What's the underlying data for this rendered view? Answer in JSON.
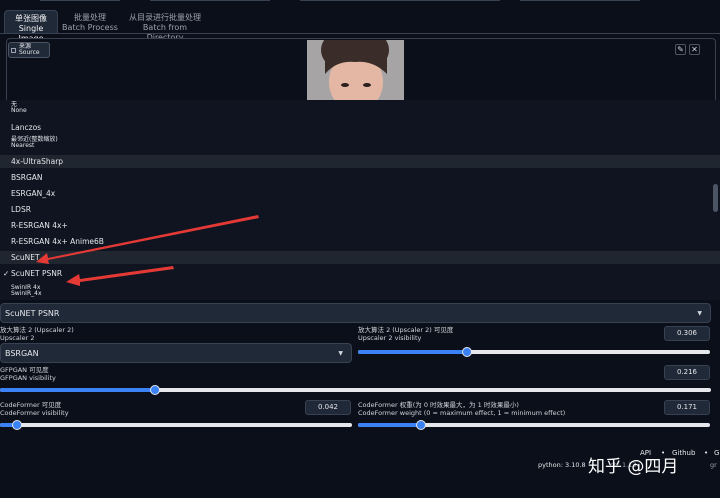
{
  "tabs": [
    {
      "zh": "单张图像",
      "en": "Single Image"
    },
    {
      "zh": "批量处理",
      "en": "Batch Process"
    },
    {
      "zh": "从目录进行批量处理",
      "en": "Batch from Directory"
    }
  ],
  "source": {
    "zh": "来源",
    "en": "Source"
  },
  "buttons": {
    "edit": "✎",
    "close": "✕"
  },
  "upscaler_options": [
    {
      "zh": "无",
      "en": "None"
    },
    {
      "label": "Lanczos"
    },
    {
      "zh": "最邻近(整数缩放)",
      "en": "Nearest"
    },
    {
      "label": "4x-UltraSharp"
    },
    {
      "label": "BSRGAN"
    },
    {
      "label": "ESRGAN_4x"
    },
    {
      "label": "LDSR"
    },
    {
      "label": "R-ESRGAN 4x+"
    },
    {
      "label": "R-ESRGAN 4x+ Anime6B"
    },
    {
      "label": "ScuNET"
    },
    {
      "label": "ScuNET PSNR",
      "check": "✓"
    },
    {
      "zh": "SwinIR 4x",
      "en": "SwinIR_4x"
    }
  ],
  "upscaler1": {
    "value": "ScuNET PSNR"
  },
  "upscaler2": {
    "label_zh": "放大算法 2 (Upscaler 2)",
    "label_en": "Upscaler 2",
    "value": "BSRGAN"
  },
  "upscaler2_visibility": {
    "label_zh": "放大算法 2 (Upscaler 2) 可见度",
    "label_en": "Upscaler 2 visibility",
    "value": "0.306"
  },
  "gfpgan": {
    "label_zh": "GFPGAN 可见度",
    "label_en": "GFPGAN visibility",
    "value": "0.216"
  },
  "codeformer_visibility": {
    "label_zh": "CodeFormer 可见度",
    "label_en": "CodeFormer visibility",
    "value": "0.042"
  },
  "codeformer_weight": {
    "label_zh": "CodeFormer 权重(为 0 时效果最大，为 1 时效果最小)",
    "label_en": "CodeFormer weight (0 = maximum effect, 1 = minimum effect)",
    "value": "0.171"
  },
  "footer": {
    "api": "API",
    "sep": "•",
    "github": "Github",
    "gradio_short": "G",
    "python": "python: 3.10.8",
    "torch_partial": "ch: 1.13",
    "gradio_partial": "gr",
    "watermark": "知乎 @四月"
  },
  "colors": {
    "background": "#0b0f19",
    "accent": "#3b82f6",
    "arrow": "#e53935"
  }
}
